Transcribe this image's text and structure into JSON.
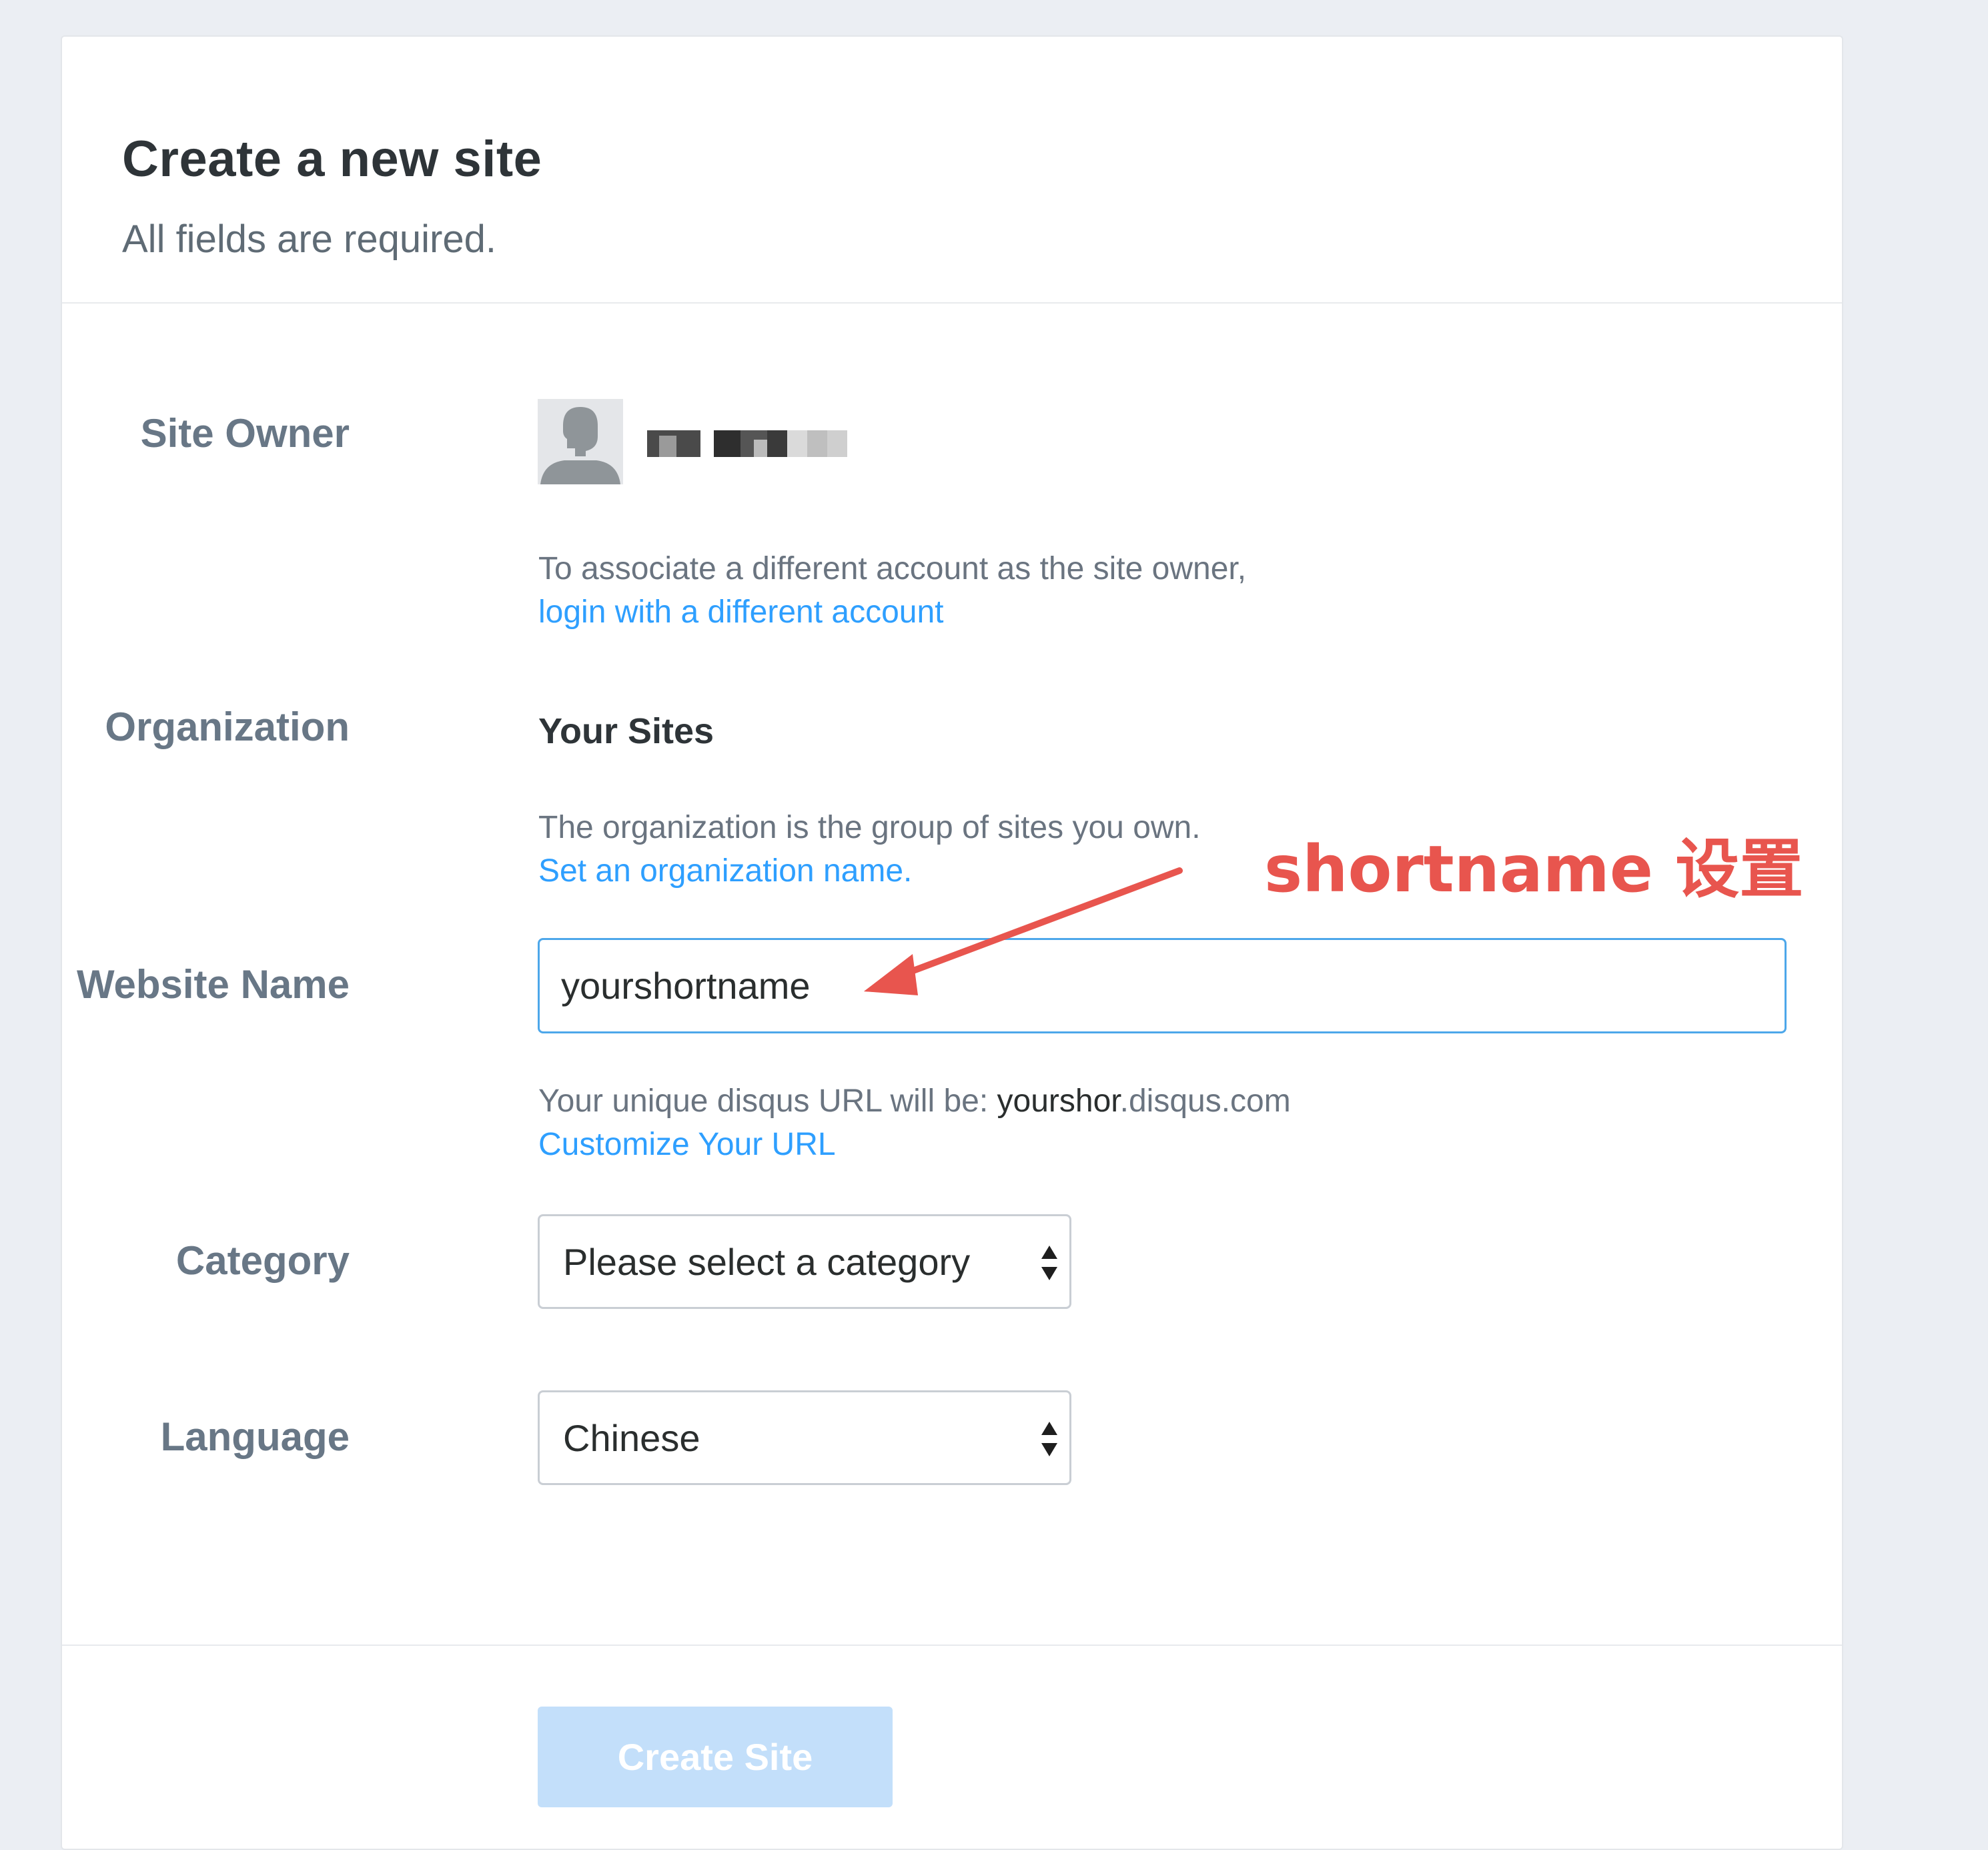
{
  "header": {
    "title": "Create a new site",
    "subtitle": "All fields are required."
  },
  "site_owner": {
    "label": "Site Owner",
    "help_text": "To associate a different account as the site owner,",
    "help_link": "login with a different account"
  },
  "organization": {
    "label": "Organization",
    "value": "Your Sites",
    "help_text": "The organization is the group of sites you own.",
    "help_link": "Set an organization name."
  },
  "website_name": {
    "label": "Website Name",
    "value": "yourshortname",
    "url_prefix": "Your unique disqus URL will be: ",
    "url_shortname": "yourshor",
    "url_suffix": ".disqus.com",
    "customize_link": "Customize Your URL"
  },
  "category": {
    "label": "Category",
    "selected": "Please select a category"
  },
  "language": {
    "label": "Language",
    "selected": "Chinese"
  },
  "footer": {
    "create_button": "Create Site"
  },
  "annotation": {
    "text": "shortname 设置",
    "color": "#e8554e"
  },
  "colors": {
    "link": "#2e9fff",
    "input_focus_border": "#4da7ea",
    "button_disabled": "#c3dffa",
    "page_background": "#ebeef3"
  }
}
